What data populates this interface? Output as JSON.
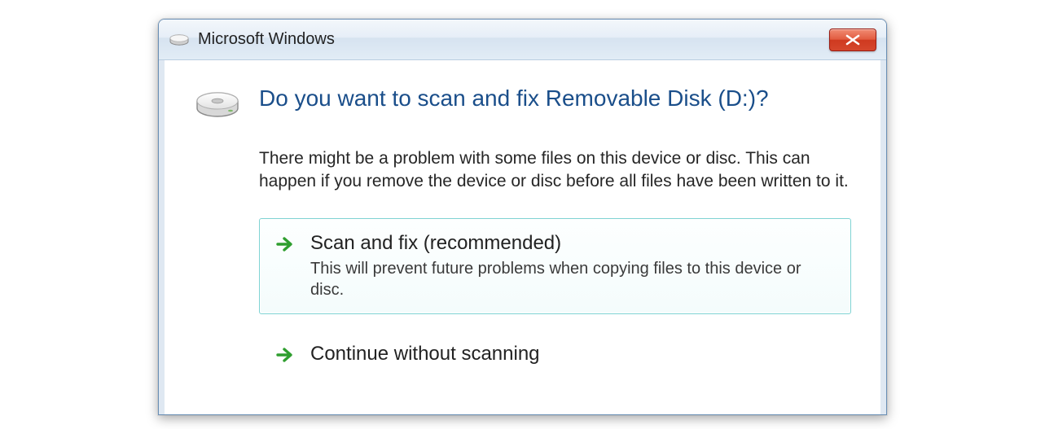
{
  "dialog": {
    "title": "Microsoft Windows",
    "heading": "Do you want to scan and fix Removable Disk (D:)?",
    "description": "There might be a problem with some files on this device or disc. This can happen if you remove the device or disc before all files have been written to it.",
    "options": [
      {
        "title": "Scan and fix (recommended)",
        "subtitle": "This will prevent future problems when copying files to this device or disc."
      },
      {
        "title": "Continue without scanning",
        "subtitle": ""
      }
    ]
  }
}
